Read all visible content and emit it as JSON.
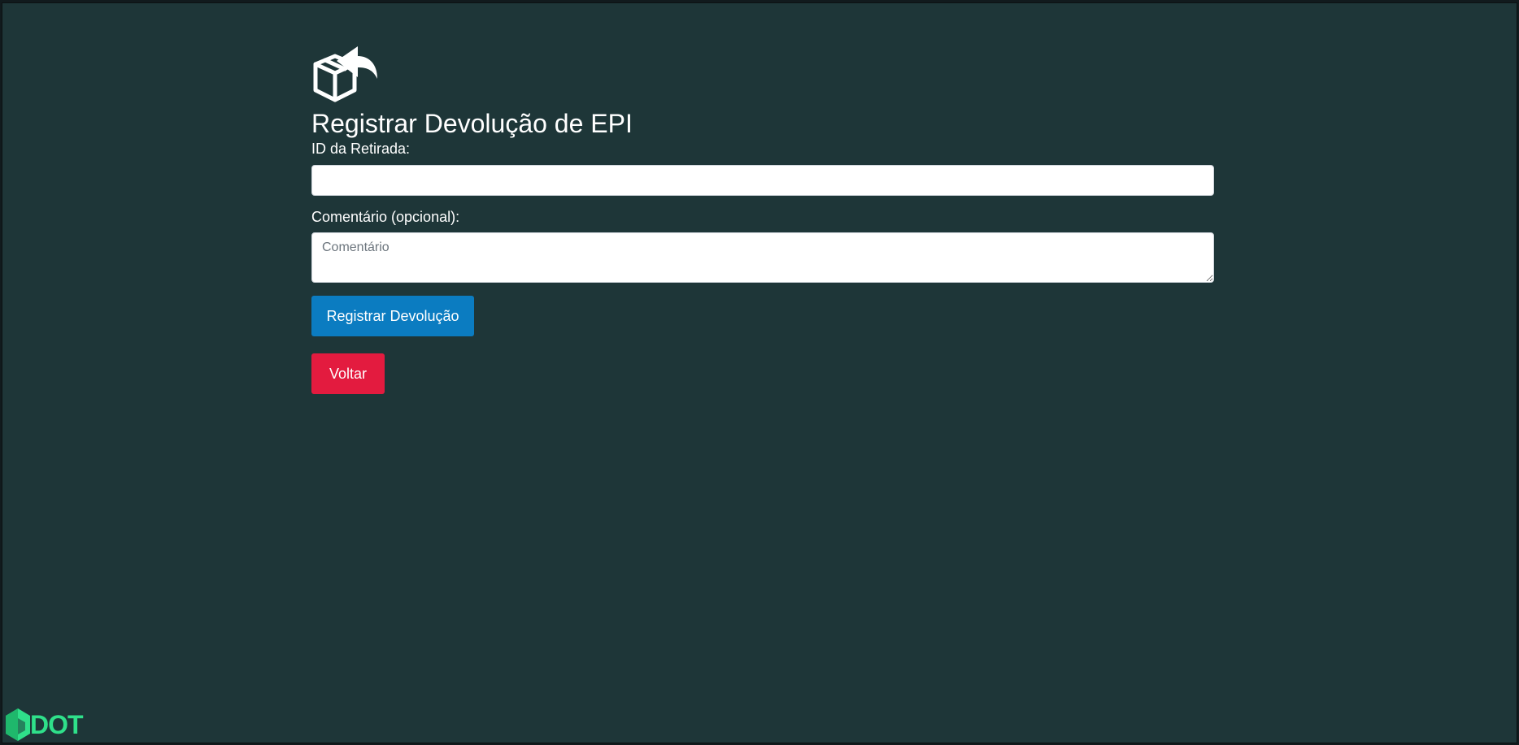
{
  "page": {
    "title": "Registrar Devolução de EPI",
    "icon": "box-return-icon",
    "background_color": "#1e3638"
  },
  "form": {
    "withdrawal_id": {
      "label": "ID da Retirada:",
      "value": "",
      "placeholder": ""
    },
    "comment": {
      "label": "Comentário (opcional):",
      "value": "",
      "placeholder": "Comentário"
    },
    "submit_label": "Registrar Devolução",
    "back_label": "Voltar"
  },
  "brand": {
    "name": "DOT",
    "icon": "dot-logo-mark",
    "color": "#2fe08a"
  },
  "colors": {
    "primary": "#0b7cc1",
    "danger": "#e31b3f"
  }
}
